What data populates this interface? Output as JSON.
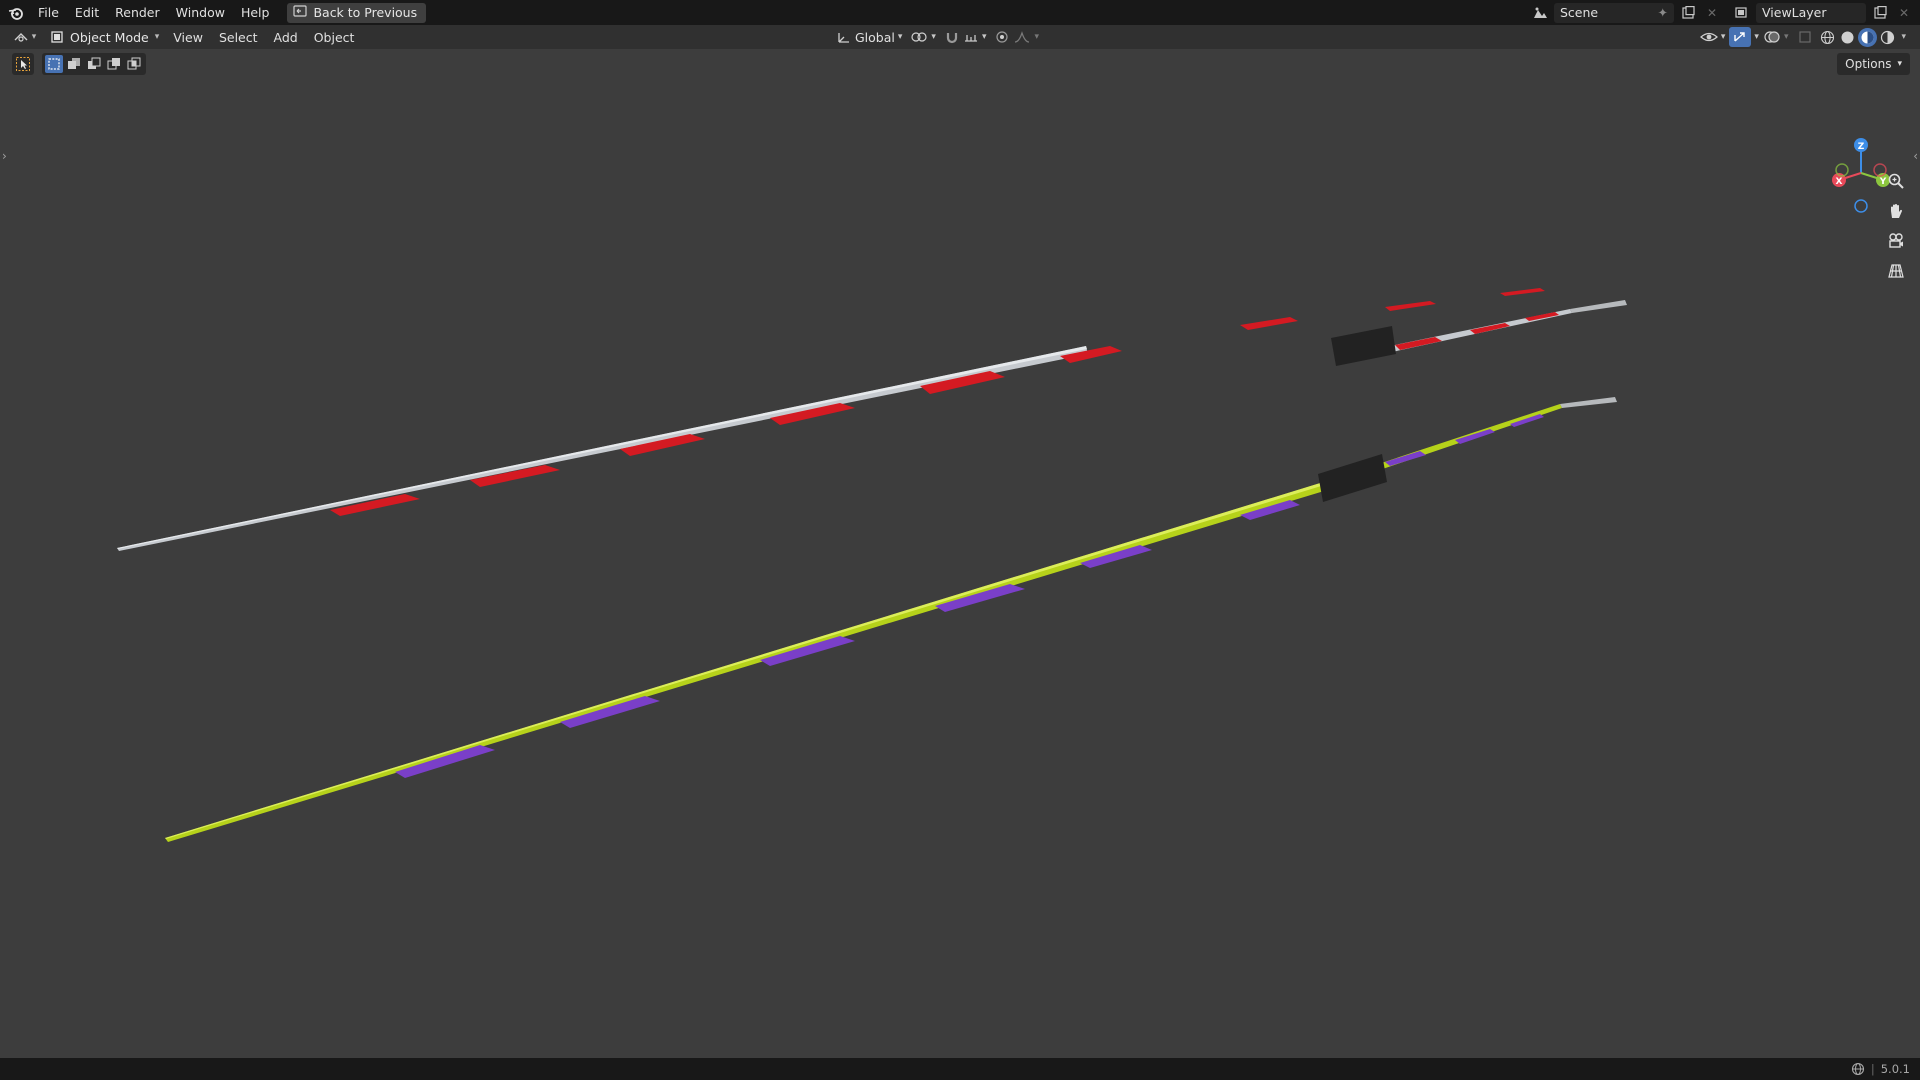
{
  "topbar": {
    "menus": [
      "File",
      "Edit",
      "Render",
      "Window",
      "Help"
    ],
    "back_label": "Back to Previous",
    "scene": "Scene",
    "view_layer": "ViewLayer"
  },
  "header": {
    "mode": "Object Mode",
    "menus": [
      "View",
      "Select",
      "Add",
      "Object"
    ],
    "transform_orientation": "Global"
  },
  "viewport": {
    "options_label": "Options",
    "gizmo_axes": {
      "x": "X",
      "y": "Y",
      "z": "Z"
    },
    "objects": [
      {
        "name": "javelin-red-white",
        "stripe_color": "#d41a22",
        "base_color": "#c8ccd0",
        "grip_color": "#222222"
      },
      {
        "name": "javelin-yellow-purple",
        "stripe_color": "#7a3fc8",
        "base_color": "#b6d21a",
        "grip_color": "#222222"
      }
    ]
  },
  "status": {
    "version": "5.0.1"
  },
  "colors": {
    "accent": "#4772b3",
    "viewport_bg": "#3d3d3d",
    "axis_x": "#e84a5a",
    "axis_y": "#8cc63f",
    "axis_z": "#3d8ee8"
  }
}
